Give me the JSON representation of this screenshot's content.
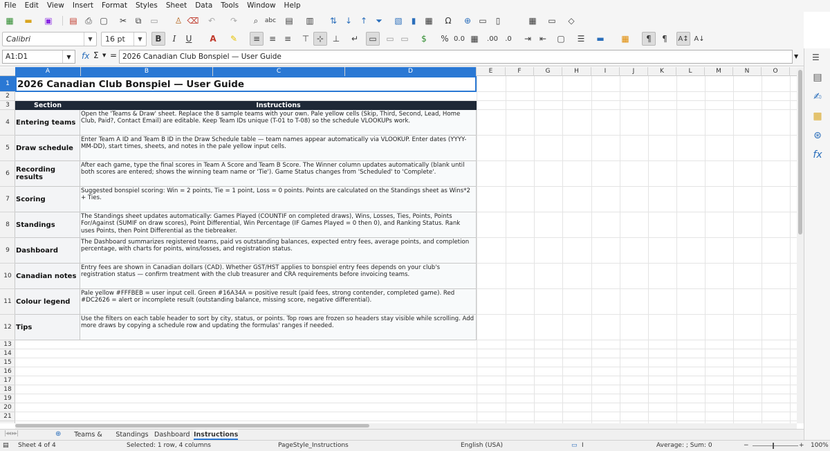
{
  "menu": [
    "File",
    "Edit",
    "View",
    "Insert",
    "Format",
    "Styles",
    "Sheet",
    "Data",
    "Tools",
    "Window",
    "Help"
  ],
  "toolbar": {
    "font_name": "Calibri",
    "font_size": "16 pt"
  },
  "formula_bar": {
    "name_box": "A1:D1",
    "content": "2026 Canadian Club Bonspiel — User Guide"
  },
  "columns": [
    "A",
    "B",
    "C",
    "D",
    "E",
    "F",
    "G",
    "H",
    "I",
    "J",
    "K",
    "L",
    "M",
    "N",
    "O"
  ],
  "rows": [
    "1",
    "2",
    "3",
    "4",
    "5",
    "6",
    "7",
    "8",
    "9",
    "10",
    "11",
    "12",
    "13",
    "14",
    "15",
    "16",
    "17",
    "18",
    "19",
    "20",
    "21"
  ],
  "sheet": {
    "title": "2026 Canadian Club Bonspiel — User Guide",
    "header_section": "Section",
    "header_instructions": "Instructions",
    "entries": [
      {
        "section": "Entering teams",
        "text": "Open the 'Teams & Draw' sheet. Replace the 8 sample teams with your own. Pale yellow cells (Skip, Third, Second, Lead, Home Club, Paid?, Contact Email) are editable. Keep Team IDs unique (T-01 to T-08) so the schedule VLOOKUPs work."
      },
      {
        "section": "Draw schedule",
        "text": "Enter Team A ID and Team B ID in the Draw Schedule table — team names appear automatically via VLOOKUP. Enter dates (YYYY-MM-DD), start times, sheets, and notes in the pale yellow input cells."
      },
      {
        "section": "Recording results",
        "text": "After each game, type the final scores in Team A Score and Team B Score. The Winner column updates automatically (blank until both scores are entered; shows the winning team name or 'Tie'). Game Status changes from 'Scheduled' to 'Complete'."
      },
      {
        "section": "Scoring",
        "text": "Suggested bonspiel scoring: Win = 2 points, Tie = 1 point, Loss = 0 points. Points are calculated on the Standings sheet as Wins*2 + Ties."
      },
      {
        "section": "Standings",
        "text": "The Standings sheet updates automatically: Games Played (COUNTIF on completed draws), Wins, Losses, Ties, Points, Points For/Against (SUMIF on draw scores), Point Differential, Win Percentage (IF Games Played = 0 then 0), and Ranking Status. Rank uses Points, then Point Differential as the tiebreaker."
      },
      {
        "section": "Dashboard",
        "text": "The Dashboard summarizes registered teams, paid vs outstanding balances, expected entry fees, average points, and completion percentage, with charts for points, wins/losses, and registration status."
      },
      {
        "section": "Canadian notes",
        "text": "Entry fees are shown in Canadian dollars (CAD). Whether GST/HST applies to bonspiel entry fees depends on your club's registration status — confirm treatment with the club treasurer and CRA requirements before invoicing teams."
      },
      {
        "section": "Colour legend",
        "text": "Pale yellow #FFFBEB = user input cell. Green #16A34A = positive result (paid fees, strong contender, completed game). Red #DC2626 = alert or incomplete result (outstanding balance, missing score, negative differential)."
      },
      {
        "section": "Tips",
        "text": "Use the filters on each table header to sort by city, status, or points. Top rows are frozen so headers stay visible while scrolling. Add more draws by copying a schedule row and updating the formulas' ranges if needed."
      }
    ]
  },
  "tabs": [
    "Teams & Draw",
    "Standings",
    "Dashboard",
    "Instructions"
  ],
  "active_tab": "Instructions",
  "status": {
    "sheet": "Sheet 4 of 4",
    "selection": "Selected: 1 row, 4 columns",
    "page_style": "PageStyle_Instructions",
    "language": "English (USA)",
    "summary": "Average: ; Sum: 0",
    "zoom": "100%"
  },
  "colors": {
    "accent": "#2a78d4",
    "header_dark": "#1f2937",
    "input_yellow": "#FFFBEB",
    "positive_green": "#16A34A",
    "alert_red": "#DC2626"
  }
}
